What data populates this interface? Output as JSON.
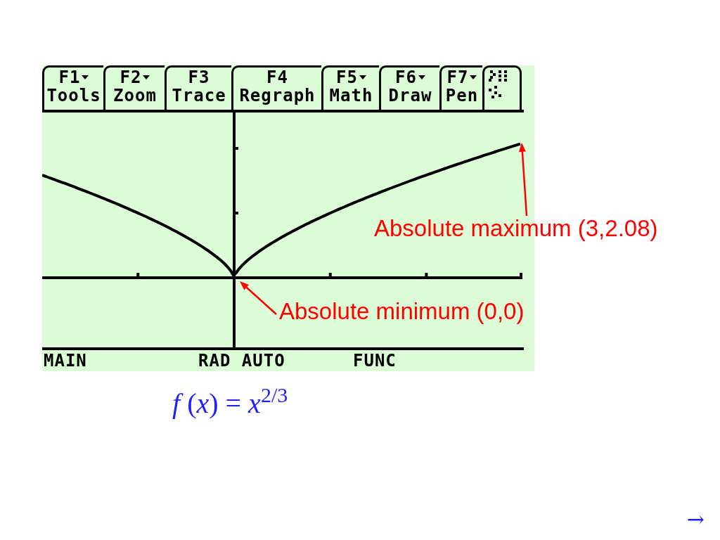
{
  "calculator_screen": {
    "toolbar": {
      "tabs": [
        {
          "key": "F1",
          "label": "Tools",
          "menu": true
        },
        {
          "key": "F2",
          "label": "Zoom",
          "menu": true
        },
        {
          "key": "F3",
          "label": "Trace",
          "menu": false
        },
        {
          "key": "F4",
          "label": "Regraph",
          "menu": false
        },
        {
          "key": "F5",
          "label": "Math",
          "menu": true
        },
        {
          "key": "F6",
          "label": "Draw",
          "menu": true
        },
        {
          "key": "F7",
          "label": "Pen",
          "menu": true
        }
      ]
    },
    "status_bar": {
      "items": [
        "MAIN",
        "RAD AUTO",
        "FUNC"
      ]
    }
  },
  "annotations": [
    "Absolute maximum (3,2.08)",
    "Absolute minimum (0,0)"
  ],
  "formula": "*f* (*x*) = *x*$^{2/3}$",
  "navigation": {
    "next": "→"
  }
}
